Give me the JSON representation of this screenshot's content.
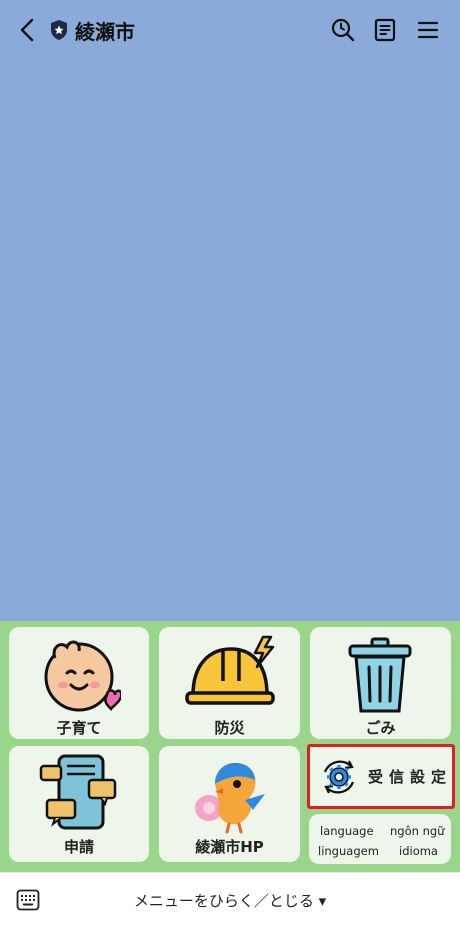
{
  "header": {
    "title": "綾瀬市",
    "back_icon": "chevron-left-icon",
    "shield_icon": "official-account-shield-icon",
    "search_icon": "search-icon",
    "notes_icon": "notes-icon",
    "menu_icon": "hamburger-menu-icon"
  },
  "colors": {
    "chat_bg": "#8aabd9",
    "menu_bg": "#9ad58c",
    "tile_bg": "#eef5ea",
    "highlight": "#e02020"
  },
  "rich_menu": {
    "tiles": [
      {
        "label": "子育て",
        "icon": "baby-with-heart-icon"
      },
      {
        "label": "防災",
        "icon": "safety-helmet-icon"
      },
      {
        "label": "ごみ",
        "icon": "trash-can-icon"
      },
      {
        "label": "申請",
        "icon": "application-documents-icon"
      },
      {
        "label": "綾瀬市HP",
        "icon": "mascot-bird-icon"
      }
    ],
    "settings": {
      "label": "受信設定",
      "icon": "gear-refresh-icon"
    },
    "languages": [
      "language",
      "ngôn ngữ",
      "linguagem",
      "idioma"
    ]
  },
  "bottom_bar": {
    "keyboard_icon": "keyboard-icon",
    "toggle_label": "メニューをひらく／とじる ▾"
  }
}
